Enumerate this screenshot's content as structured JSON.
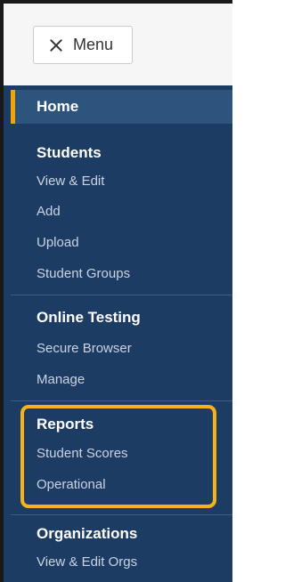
{
  "menu_button": {
    "label": "Menu",
    "icon": "close-icon"
  },
  "nav": {
    "home": "Home",
    "sections": [
      {
        "heading": "Students",
        "items": [
          "View & Edit",
          "Add",
          "Upload",
          "Student Groups"
        ]
      },
      {
        "heading": "Online Testing",
        "items": [
          "Secure Browser",
          "Manage"
        ]
      },
      {
        "heading": "Reports",
        "items": [
          "Student Scores",
          "Operational"
        ],
        "highlighted": true
      },
      {
        "heading": "Organizations",
        "items": [
          "View & Edit Orgs"
        ]
      }
    ]
  },
  "colors": {
    "sidebar_bg": "#1d3c63",
    "active_bg": "#2d547d",
    "accent": "#f0a500",
    "highlight_border": "#f5b319",
    "link_text": "#c9d4e2"
  }
}
